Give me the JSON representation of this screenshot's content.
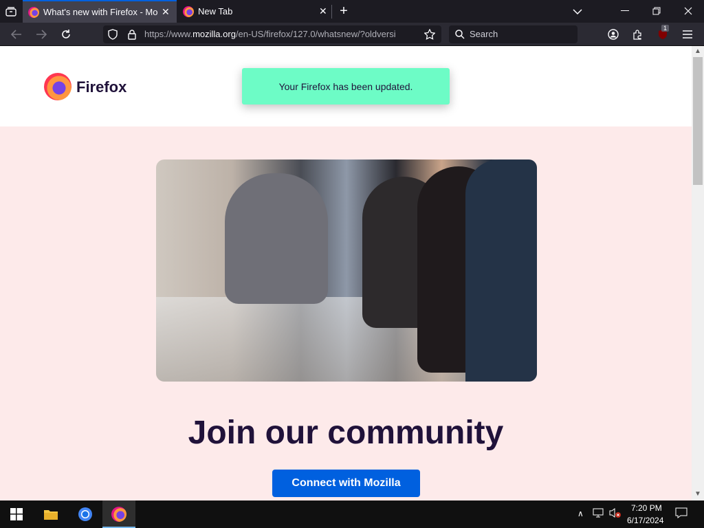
{
  "browser": {
    "tabs": [
      {
        "title": "What's new with Firefox - More",
        "active": true
      },
      {
        "title": "New Tab",
        "active": false
      }
    ],
    "url": {
      "prefix": "https://www.",
      "domain": "mozilla.org",
      "path": "/en-US/firefox/127.0/whatsnew/?oldversi"
    },
    "search_placeholder": "Search",
    "extension_badge": "1"
  },
  "page": {
    "logo_text": "Firefox",
    "toast": "Your Firefox has been updated.",
    "headline": "Join our community",
    "cta": "Connect with Mozilla"
  },
  "taskbar": {
    "time": "7:20 PM",
    "date": "6/17/2024"
  },
  "icons": [
    "tab-list-icon",
    "firefox-icon",
    "close-icon",
    "new-tab-icon",
    "chevron-down-icon",
    "minimize-icon",
    "restore-icon",
    "back-icon",
    "forward-icon",
    "reload-icon",
    "shield-icon",
    "lock-icon",
    "star-icon",
    "search-icon",
    "account-icon",
    "extensions-icon",
    "ublock-icon",
    "menu-icon",
    "windows-start-icon",
    "file-explorer-icon",
    "chrome-icon",
    "notification-icon"
  ]
}
